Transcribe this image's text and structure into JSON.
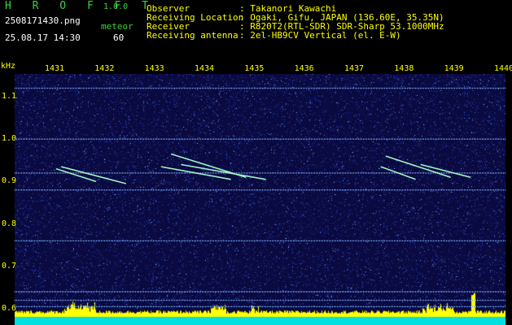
{
  "header": {
    "logo": "H R O F F T",
    "version": "1.0.0",
    "filename": "2508171430.png",
    "datetime": "25.08.17 14:30",
    "meteor_label": "meteor",
    "meteor_count": "60"
  },
  "info": [
    {
      "key": "Observer",
      "value": ": Takanori Kawachi"
    },
    {
      "key": "Receiving Location",
      "value": ": Ogaki, Gifu, JAPAN (136.60E, 35.35N)"
    },
    {
      "key": "Receiver",
      "value": ": R820T2(RTL-SDR) SDR-Sharp 53.1000MHz"
    },
    {
      "key": "Receiving antenna",
      "value": ": 2el-HB9CV Vertical (el. E-W)"
    }
  ],
  "colors": {
    "header_green": "#3fd23f",
    "label_yellow": "#ffff00",
    "background": "#0a0a40"
  },
  "chart_data": {
    "type": "heatmap",
    "ylabel": "kHz",
    "x_tick_labels": [
      "1431",
      "1432",
      "1433",
      "1434",
      "1435",
      "1436",
      "1437",
      "1438",
      "1439",
      "1440"
    ],
    "y_tick_labels": [
      "1.1",
      "1.0",
      "0.9",
      "0.8",
      "0.7",
      "0.6"
    ],
    "x_range": [
      1431,
      1440
    ],
    "y_range": [
      0.6,
      1.1
    ],
    "horizontal_lines_khz": [
      1.12,
      1.0,
      0.92,
      0.88,
      0.76,
      0.64,
      0.62,
      0.605
    ],
    "meteor_echoes": [
      {
        "x0": 1431.0,
        "y0": 0.93,
        "x1": 1431.8,
        "y1": 0.9
      },
      {
        "x0": 1431.1,
        "y0": 0.935,
        "x1": 1432.4,
        "y1": 0.895
      },
      {
        "x0": 1433.3,
        "y0": 0.965,
        "x1": 1434.8,
        "y1": 0.91
      },
      {
        "x0": 1433.5,
        "y0": 0.94,
        "x1": 1435.2,
        "y1": 0.905
      },
      {
        "x0": 1433.1,
        "y0": 0.935,
        "x1": 1434.5,
        "y1": 0.905
      },
      {
        "x0": 1437.6,
        "y0": 0.96,
        "x1": 1438.9,
        "y1": 0.91
      },
      {
        "x0": 1437.5,
        "y0": 0.935,
        "x1": 1438.2,
        "y1": 0.905
      },
      {
        "x0": 1438.3,
        "y0": 0.94,
        "x1": 1439.3,
        "y1": 0.91
      }
    ]
  }
}
